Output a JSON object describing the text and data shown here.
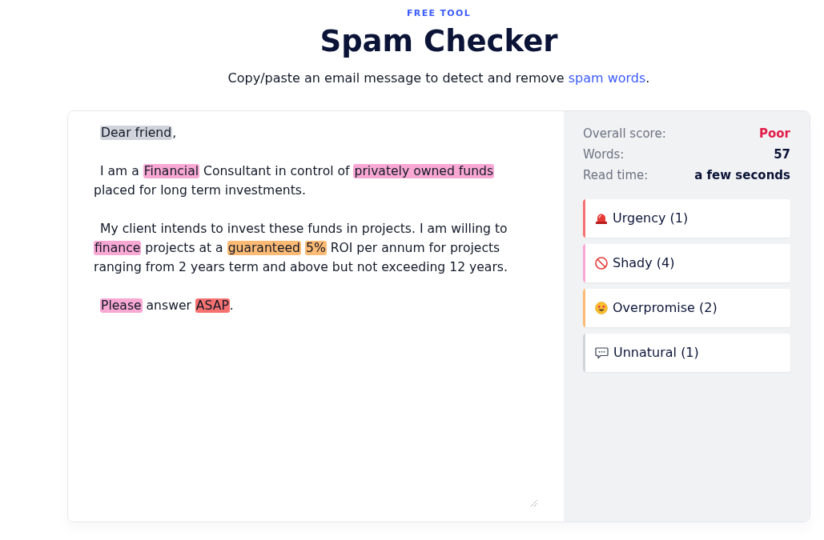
{
  "header": {
    "eyebrow": "FREE TOOL",
    "title": "Spam Checker",
    "subtitle": {
      "before": "Copy/paste an email message to detect and remove ",
      "link": "spam words",
      "after": "."
    }
  },
  "editor": {
    "paragraphs": [
      {
        "segments": [
          {
            "text": "Dear friend",
            "color": "#d1d5db"
          },
          {
            "text": ","
          }
        ]
      },
      {
        "segments": [
          {
            "text": "I am a "
          },
          {
            "text": "Financial",
            "color": "#f9a8d4"
          },
          {
            "text": " Consultant in control of "
          },
          {
            "text": "privately owned funds",
            "color": "#f9a8d4"
          },
          {
            "text": " placed for long term investments."
          }
        ]
      },
      {
        "segments": [
          {
            "text": "My client intends to invest these funds in projects. I am willing to "
          },
          {
            "text": "finance",
            "color": "#f9a8d4"
          },
          {
            "text": " projects at a "
          },
          {
            "text": "guaranteed",
            "color": "#fdba74"
          },
          {
            "text": "5%",
            "color": "#fdba74"
          },
          {
            "text": " ROI per annum for projects "
          },
          {
            "text": "ranging from 2 years term and above but not exceeding 12 years."
          }
        ]
      },
      {
        "segments": [
          {
            "text": "Please",
            "color": "#f9a8d4"
          },
          {
            "text": " answer "
          },
          {
            "text": "ASAP",
            "color": "#f87171"
          },
          {
            "text": "."
          }
        ]
      }
    ]
  },
  "stats": [
    {
      "label": "Overall score:",
      "value": "Poor",
      "color": "#e11d48"
    },
    {
      "label": "Words:",
      "value": "57",
      "color": "#0b1437"
    },
    {
      "label": "Read time:",
      "value": "a few seconds",
      "color": "#0b1437"
    }
  ],
  "categories": [
    {
      "kind": "urgency",
      "label": "Urgency (1)",
      "color": "#f87171"
    },
    {
      "kind": "shady",
      "label": "Shady (4)",
      "color": "#f9a8d4"
    },
    {
      "kind": "overpromise",
      "label": "Overpromise (2)",
      "color": "#fdba74"
    },
    {
      "kind": "unnatural",
      "label": "Unnatural (1)",
      "color": "#d1d5db"
    }
  ]
}
